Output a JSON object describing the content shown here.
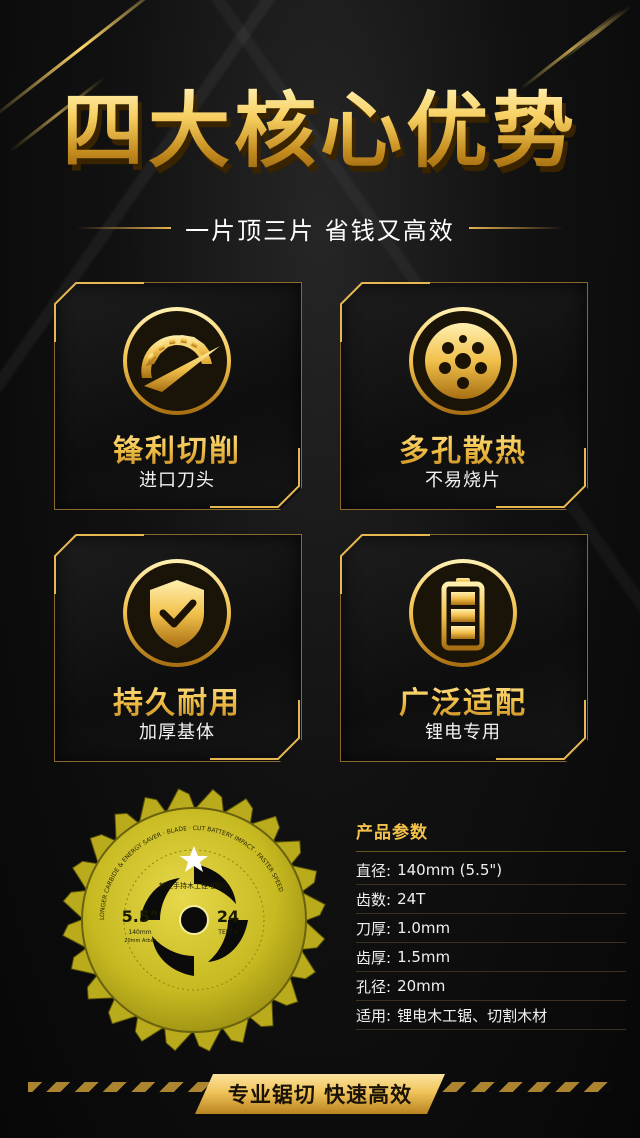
{
  "header": {
    "title": "四大核心优势",
    "subtitle": "一片顶三片 省钱又高效"
  },
  "features": [
    {
      "title": "锋利切削",
      "subtitle": "进口刀头",
      "icon": "saw-speedometer-icon"
    },
    {
      "title": "多孔散热",
      "subtitle": "不易烧片",
      "icon": "holes-disc-icon"
    },
    {
      "title": "持久耐用",
      "subtitle": "加厚基体",
      "icon": "shield-check-icon"
    },
    {
      "title": "广泛适配",
      "subtitle": "锂电专用",
      "icon": "battery-icon"
    }
  ],
  "blade": {
    "size_label": "5.5\"",
    "teeth_label": "24",
    "teeth_unit": "TEETH",
    "brand_line": "新型手持木工锂电锯片",
    "diameter_mm": "140mm",
    "bore_mm": "20mm Arbor",
    "rim_text": "LONGER CARBIDE & ENERGY SAVER · BLADE · CUT BATTERY IMPACT · FASTER SPEED"
  },
  "params": {
    "title": "产品参数",
    "rows": [
      {
        "label": "直径:",
        "value": "140mm (5.5\")"
      },
      {
        "label": "齿数:",
        "value": "24T"
      },
      {
        "label": "刀厚:",
        "value": "1.0mm"
      },
      {
        "label": "齿厚:",
        "value": "1.5mm"
      },
      {
        "label": "孔径:",
        "value": "20mm"
      },
      {
        "label": "适用:",
        "value": "锂电木工锯、切割木材"
      }
    ]
  },
  "banner": {
    "text": "专业锯切  快速高效"
  },
  "colors": {
    "gold": "#f4c24a",
    "background": "#0b0b0b",
    "blade_yellow": "#c9bd22"
  }
}
